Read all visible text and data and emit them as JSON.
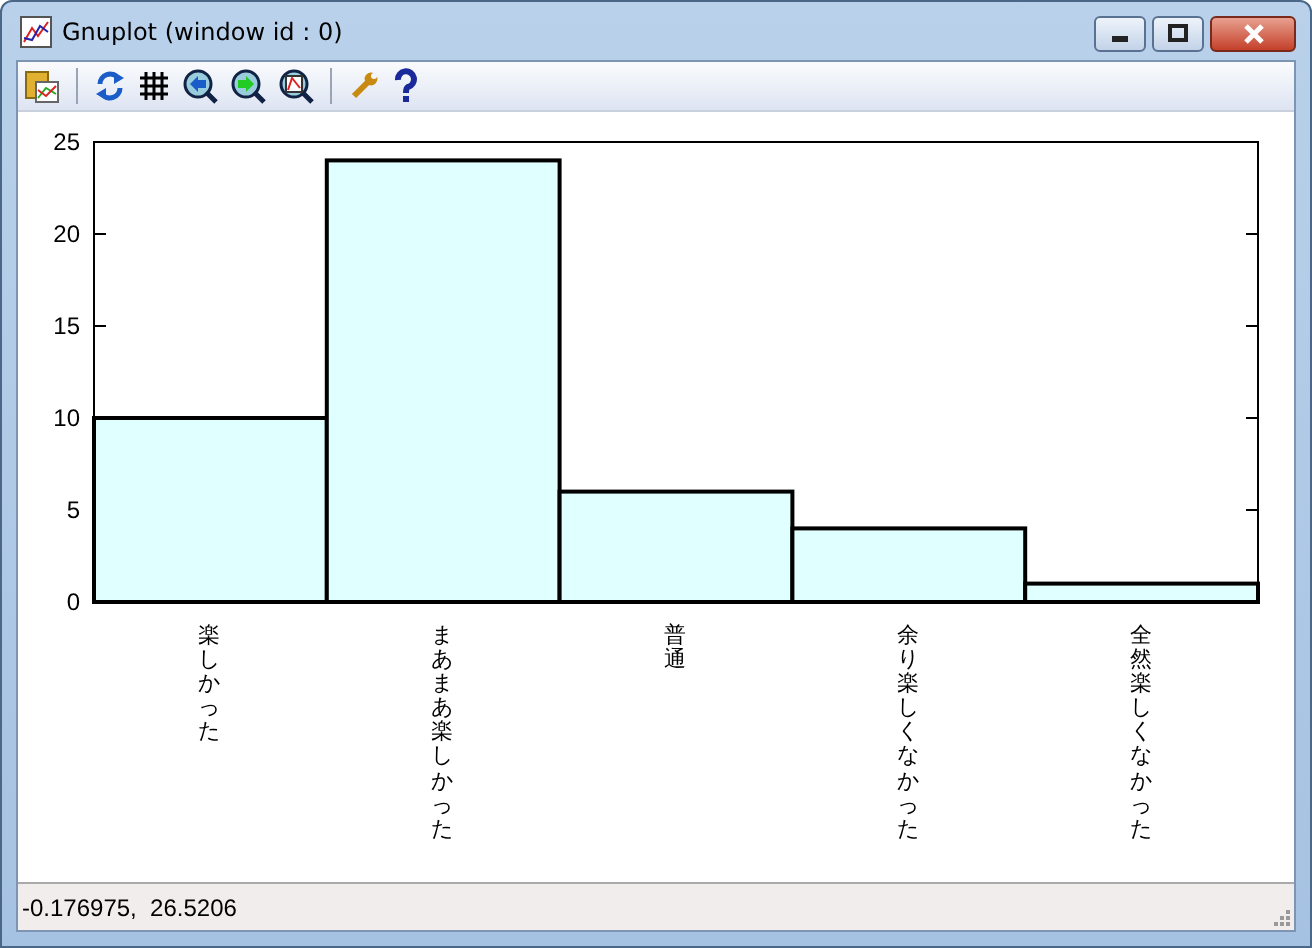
{
  "window": {
    "title": "Gnuplot (window id : 0)"
  },
  "plot": {
    "chart_data": {
      "type": "bar",
      "categories": [
        "楽しかった",
        "まあまあ楽しかった",
        "普通",
        "余り楽しくなかった",
        "全然楽しくなかった"
      ],
      "values": [
        10,
        24,
        6,
        4,
        1
      ],
      "ylim": [
        0,
        25
      ],
      "yticks": [
        0,
        5,
        10,
        15,
        20,
        25
      ]
    }
  },
  "status_bar": {
    "text": "-0.176975,  26.5206"
  }
}
